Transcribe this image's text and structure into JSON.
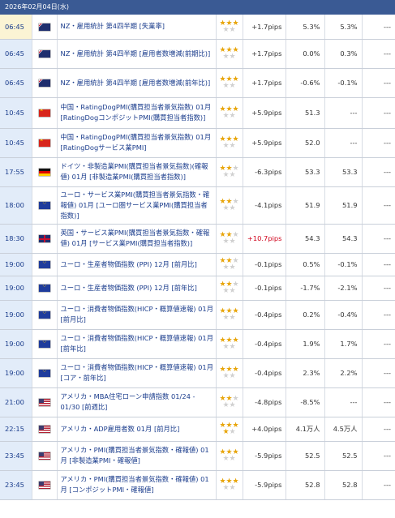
{
  "header": {
    "date": "2026年02月04日(水)"
  },
  "colors": {
    "header_bg": "#3a5a94",
    "time_bg": "#e2ecf9",
    "first_row_bg": "#fbf4d4",
    "star_on": "#e8a50a",
    "pips_up": "#d0021b"
  },
  "rows": [
    {
      "time": "06:45",
      "flag": "nz-flag-icon",
      "event": "NZ・雇用統計 第4四半期 [失業率]",
      "stars": 3,
      "pips": "+1.7pips",
      "pips_up": false,
      "result": "5.3%",
      "forecast": "5.3%",
      "previous": "---",
      "height": 30
    },
    {
      "time": "06:45",
      "flag": "nz-flag-icon",
      "event": "NZ・雇用統計 第4四半期 [雇用者数増減(前期比)]",
      "stars": 3,
      "pips": "+1.7pips",
      "pips_up": false,
      "result": "0.0%",
      "forecast": "0.3%",
      "previous": "---",
      "height": 36
    },
    {
      "time": "06:45",
      "flag": "nz-flag-icon",
      "event": "NZ・雇用統計 第4四半期 [雇用者数増減(前年比)]",
      "stars": 3,
      "pips": "+1.7pips",
      "pips_up": false,
      "result": "-0.6%",
      "forecast": "-0.1%",
      "previous": "---",
      "height": 36
    },
    {
      "time": "10:45",
      "flag": "cn-flag-icon",
      "event": "中国・RatingDogPMI(購買担当者景気指数) 01月 [RatingDogコンポジットPMI(購買担当者指数)]",
      "stars": 3,
      "pips": "+5.9pips",
      "pips_up": false,
      "result": "51.3",
      "forecast": "---",
      "previous": "---",
      "height": 38
    },
    {
      "time": "10:45",
      "flag": "cn-flag-icon",
      "event": "中国・RatingDogPMI(購買担当者景気指数) 01月 [RatingDogサービス業PMI]",
      "stars": 3,
      "pips": "+5.9pips",
      "pips_up": false,
      "result": "52.0",
      "forecast": "---",
      "previous": "---",
      "height": 36
    },
    {
      "time": "17:55",
      "flag": "de-flag-icon",
      "event": "ドイツ・非製造業PMI(購買担当者景気指数)(確報値) 01月 [非製造業PMI(購買担当者指数)]",
      "stars": 2,
      "pips": "-6.3pips",
      "pips_up": false,
      "result": "53.3",
      "forecast": "53.3",
      "previous": "---",
      "height": 36
    },
    {
      "time": "18:00",
      "flag": "eu-flag-icon",
      "event": "ユーロ・サービス業PMI(購買担当者景気指数・確報値) 01月 [ユーロ圏サービス業PMI(購買担当者指数)]",
      "stars": 2,
      "pips": "-4.1pips",
      "pips_up": false,
      "result": "51.9",
      "forecast": "51.9",
      "previous": "---",
      "height": 46
    },
    {
      "time": "18:30",
      "flag": "uk-flag-icon",
      "event": "英国・サービス業PMI(購買担当者景気指数・確報値) 01月 [サービス業PMI(購買担当者指数)]",
      "stars": 2,
      "pips": "+10.7pips",
      "pips_up": true,
      "result": "54.3",
      "forecast": "54.3",
      "previous": "---",
      "height": 36
    },
    {
      "time": "19:00",
      "flag": "eu-flag-icon",
      "event": "ユーロ・生産者物価指数 (PPI) 12月 [前月比]",
      "stars": 2,
      "pips": "-0.1pips",
      "pips_up": false,
      "result": "0.5%",
      "forecast": "-0.1%",
      "previous": "---",
      "height": 28
    },
    {
      "time": "19:00",
      "flag": "eu-flag-icon",
      "event": "ユーロ・生産者物価指数 (PPI) 12月 [前年比]",
      "stars": 2,
      "pips": "-0.1pips",
      "pips_up": false,
      "result": "-1.7%",
      "forecast": "-2.1%",
      "previous": "---",
      "height": 30
    },
    {
      "time": "19:00",
      "flag": "eu-flag-icon",
      "event": "ユーロ・消費者物価指数(HICP・概算値速報) 01月 [前月比]",
      "stars": 3,
      "pips": "-0.4pips",
      "pips_up": false,
      "result": "0.2%",
      "forecast": "-0.4%",
      "previous": "---",
      "height": 36
    },
    {
      "time": "19:00",
      "flag": "eu-flag-icon",
      "event": "ユーロ・消費者物価指数(HICP・概算値速報) 01月 [前年比]",
      "stars": 3,
      "pips": "-0.4pips",
      "pips_up": false,
      "result": "1.9%",
      "forecast": "1.7%",
      "previous": "---",
      "height": 36
    },
    {
      "time": "19:00",
      "flag": "eu-flag-icon",
      "event": "ユーロ・消費者物価指数(HICP・概算値速報) 01月 [コア・前年比]",
      "stars": 3,
      "pips": "-0.4pips",
      "pips_up": false,
      "result": "2.3%",
      "forecast": "2.2%",
      "previous": "---",
      "height": 36
    },
    {
      "time": "21:00",
      "flag": "us-flag-icon",
      "event": "アメリカ・MBA住宅ローン申請指数 01/24 - 01/30 [前週比]",
      "stars": 2,
      "pips": "-4.8pips",
      "pips_up": false,
      "result": "-8.5%",
      "forecast": "---",
      "previous": "---",
      "height": 36
    },
    {
      "time": "22:15",
      "flag": "us-flag-icon",
      "event": "アメリカ・ADP雇用者数 01月 [前月比]",
      "stars": 4,
      "pips": "+4.0pips",
      "pips_up": false,
      "result": "4.1万人",
      "forecast": "4.5万人",
      "previous": "---",
      "height": 30
    },
    {
      "time": "23:45",
      "flag": "us-flag-icon",
      "event": "アメリカ・PMI(購買担当者景気指数・確報値) 01月 [非製造業PMI・確報値]",
      "stars": 3,
      "pips": "-5.9pips",
      "pips_up": false,
      "result": "52.5",
      "forecast": "52.5",
      "previous": "---",
      "height": 36
    },
    {
      "time": "23:45",
      "flag": "us-flag-icon",
      "event": "アメリカ・PMI(購買担当者景気指数・確報値) 01月 [コンポジットPMI・確報値]",
      "stars": 3,
      "pips": "-5.9pips",
      "pips_up": false,
      "result": "52.8",
      "forecast": "52.8",
      "previous": "---",
      "height": 36
    }
  ]
}
